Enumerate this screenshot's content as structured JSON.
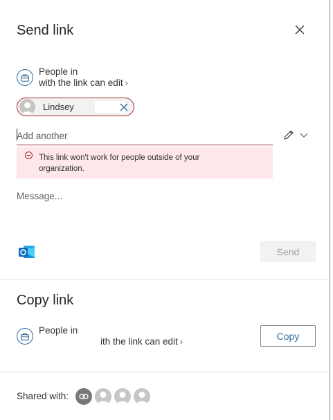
{
  "send_link": {
    "title": "Send link",
    "permission": {
      "line1": "People in",
      "line2": "with the link can edit",
      "chevron": "›"
    },
    "recipient_chip": {
      "name": "Lindsey"
    },
    "add_input": {
      "placeholder": "Add another",
      "value": ""
    },
    "error": {
      "message": "This link won't work for people outside of your organization."
    },
    "message_field": {
      "placeholder": "Message...",
      "value": ""
    },
    "send_button": {
      "label": "Send",
      "enabled": false
    }
  },
  "copy_link": {
    "title": "Copy link",
    "permission": {
      "line1": "People in",
      "line2": "ith the link can edit",
      "chevron": "›"
    },
    "copy_button": {
      "label": "Copy"
    }
  },
  "shared_with": {
    "label": "Shared with:",
    "avatars": [
      "link-icon",
      "person-icon",
      "person-icon",
      "person-icon"
    ]
  },
  "colors": {
    "accent": "#2b6a9e",
    "error_border": "#a4262c",
    "error_bg": "#fde7e9",
    "disabled_bg": "#f3f2f1",
    "disabled_text": "#a19f9d",
    "outlook_blue": "#0f6cbd"
  },
  "icons": {
    "close": "close-icon",
    "permission": "briefcase-icon",
    "chip_remove": "close-icon",
    "edit": "pencil-icon",
    "edit_dropdown": "chevron-down-icon",
    "error": "error-circle-icon",
    "outlook": "outlook-icon"
  }
}
